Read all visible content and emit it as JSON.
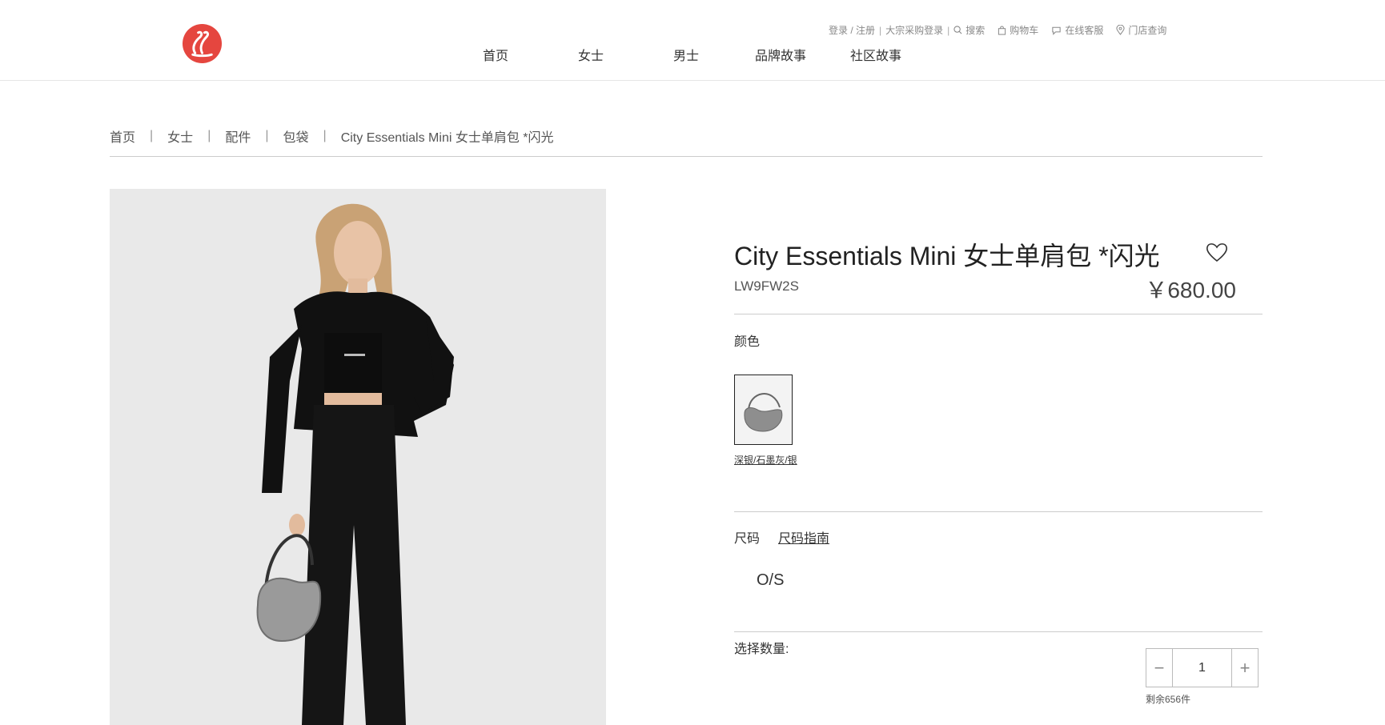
{
  "header": {
    "utility": {
      "login": "登录 / 注册",
      "bulk": "大宗采购登录",
      "search": "搜索",
      "cart": "购物车",
      "service": "在线客服",
      "stores": "门店查询"
    },
    "nav": [
      "首页",
      "女士",
      "男士",
      "品牌故事",
      "社区故事"
    ]
  },
  "breadcrumb": [
    "首页",
    "女士",
    "配件",
    "包袋",
    "City Essentials Mini 女士单肩包 *闪光"
  ],
  "product": {
    "title": "City Essentials Mini 女士单肩包 *闪光",
    "sku": "LW9FW2S",
    "price": "￥680.00",
    "color_label": "颜色",
    "color_name": "深银/石墨灰/银",
    "size_label": "尺码",
    "size_guide": "尺码指南",
    "size_value": "O/S",
    "qty_label": "选择数量:",
    "qty_value": "1",
    "stock_note": "剩余656件"
  },
  "colors": {
    "brand": "#e5463f",
    "text": "#333333",
    "divider": "#cccccc"
  },
  "icons": [
    "logo",
    "search-icon",
    "bag-icon",
    "chat-icon",
    "location-icon",
    "heart-icon",
    "minus-icon",
    "plus-icon"
  ]
}
